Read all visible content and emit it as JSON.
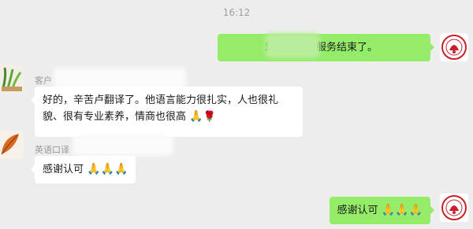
{
  "timestamp": "16:12",
  "messages": [
    {
      "direction": "outgoing",
      "text": "您好，翻译服务结束了。"
    },
    {
      "direction": "incoming",
      "sender": "客户",
      "text": "好的，辛苦卢翻译了。他语言能力很扎实，人也很礼貌、很有专业素养，情商也很高",
      "emoji": "🙏🌹"
    },
    {
      "direction": "incoming",
      "sender": "英语口译",
      "text": "感谢认可",
      "emoji": "🙏🙏🙏"
    },
    {
      "direction": "outgoing",
      "text": "感谢认可",
      "emoji": "🙏🙏🙏"
    }
  ],
  "colors": {
    "background": "#ededed",
    "outgoing_bubble": "#95ec69",
    "incoming_bubble": "#ffffff",
    "seal_red": "#c8202a"
  },
  "icons": [
    "plant-avatar-icon",
    "leaf-avatar-icon",
    "seal-avatar-icon",
    "pray-emoji",
    "rose-emoji"
  ]
}
